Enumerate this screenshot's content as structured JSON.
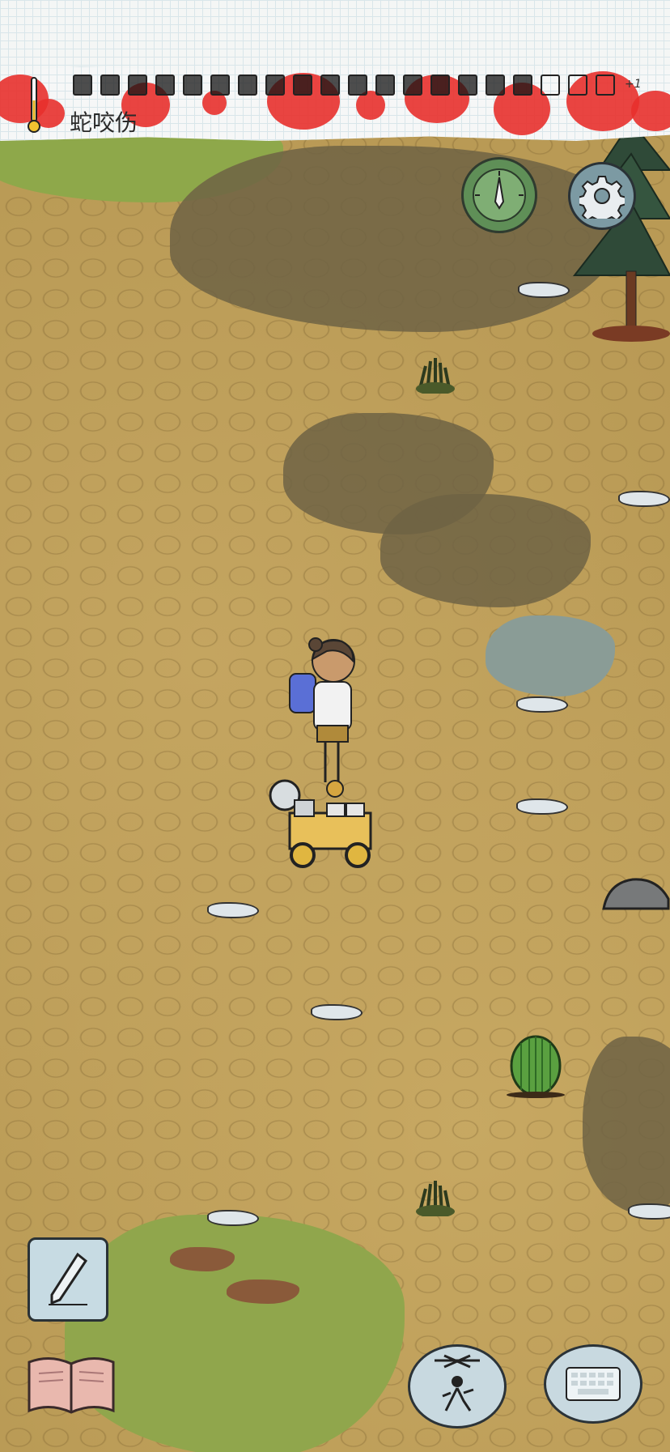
{
  "status": {
    "ailment_text": "蛇咬伤",
    "day_counter_extra": "+1",
    "filled_days": 17,
    "empty_days": 3
  },
  "icons": {
    "thermometer": "thermometer-icon",
    "compass": "compass-icon",
    "settings": "gear-icon",
    "pencil": "pencil-icon",
    "journal": "journal-book-icon",
    "puppet": "puppet-marionette-icon",
    "keyboard": "keyboard-icon"
  },
  "colors": {
    "blood": "#e8302c",
    "compass": "#5f8f57",
    "settings": "#7c9aa3",
    "bubble": "#c8d9e0"
  }
}
